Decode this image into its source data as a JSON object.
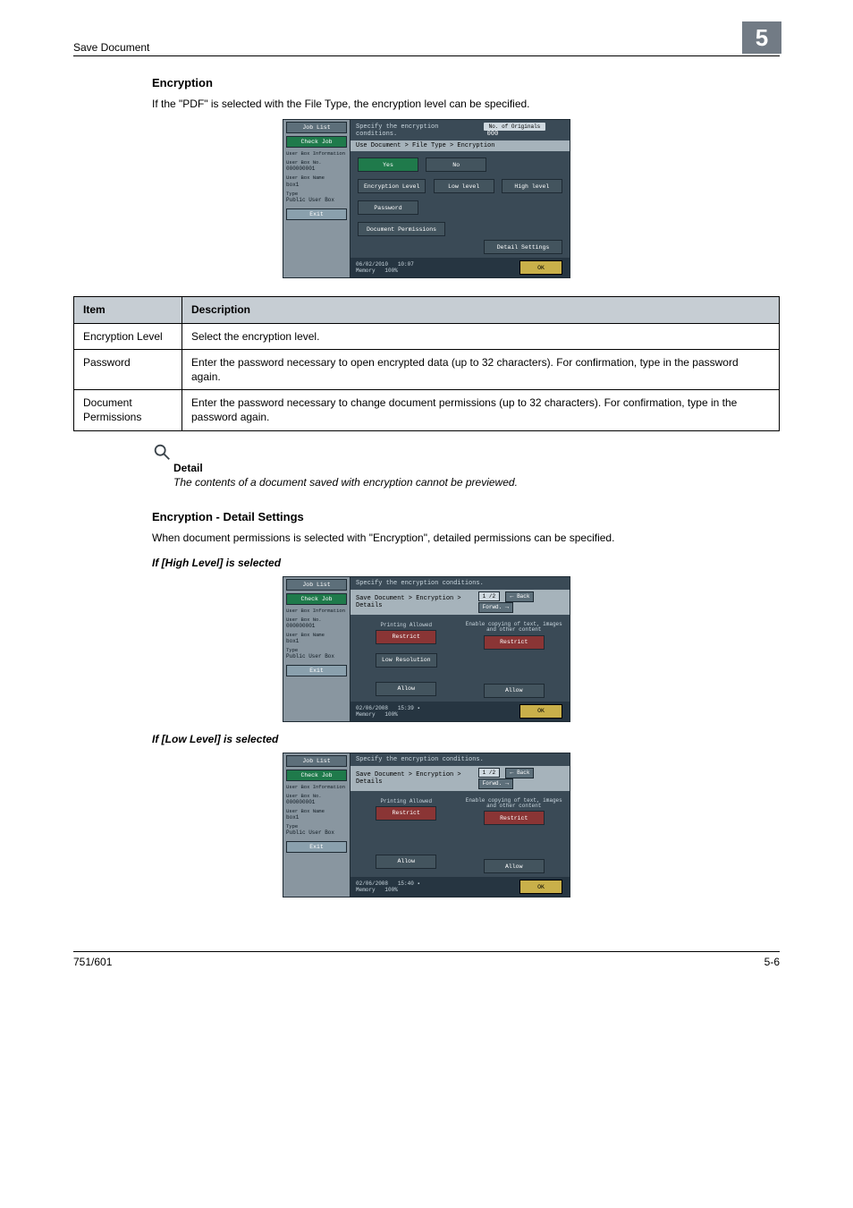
{
  "header": {
    "title": "Save Document",
    "chapter": "5"
  },
  "section1": {
    "heading": "Encryption",
    "intro": "If the \"PDF\" is selected with the File Type, the encryption level can be specified."
  },
  "table": {
    "h_item": "Item",
    "h_desc": "Description",
    "rows": [
      {
        "item": "Encryption Level",
        "desc": "Select the encryption level."
      },
      {
        "item": "Password",
        "desc": "Enter the password necessary to open encrypted data (up to 32 characters). For confirmation, type in the password again."
      },
      {
        "item": "Document Permissions",
        "desc": "Enter the password necessary to change document permissions (up to 32 characters). For confirmation, type in the password again."
      }
    ]
  },
  "detail": {
    "label": "Detail",
    "text": "The contents of a document saved with encryption cannot be previewed."
  },
  "section2": {
    "heading": "Encryption - Detail Settings",
    "intro": "When document permissions is selected with \"Encryption\", detailed permissions can be specified.",
    "case_high": "If [High Level] is selected",
    "case_low": "If [Low Level] is selected"
  },
  "panel_shared": {
    "job_list": "Job List",
    "check_job": "Check Job",
    "user_box_info": "User Box Information",
    "user_box_no_lbl": "User Box No.",
    "user_box_no_val": "000000001",
    "user_box_name_lbl": "User Box Name",
    "user_box_name_val": "box1",
    "type_lbl": "Type",
    "type_val": "Public User Box",
    "exit": "Exit",
    "memory_lbl": "Memory",
    "memory_val": "100%",
    "ok": "OK"
  },
  "panel1": {
    "title": "Specify the encryption conditions.",
    "count_lbl": "No. of Originals",
    "count_val": "000",
    "bread": "Use Document > File Type > Encryption",
    "yes": "Yes",
    "no": "No",
    "enc_level": "Encryption Level",
    "low": "Low level",
    "high": "High level",
    "password": "Password",
    "doc_perm": "Document Permissions",
    "detail_settings": "Detail Settings",
    "date": "06/02/2010",
    "time": "10:07"
  },
  "panel2": {
    "title": "Specify the encryption conditions.",
    "bread": "Save Document > Encryption > Details",
    "page": "1 /2",
    "back": "Back",
    "forwd": "Forwd.",
    "col1_title": "Printing Allowed",
    "col2_title": "Enable copying of text, images and other content",
    "restrict": "Restrict",
    "low_res": "Low Resolution",
    "allow": "Allow",
    "date": "02/06/2008",
    "time": "15:39"
  },
  "panel3": {
    "title": "Specify the encryption conditions.",
    "bread": "Save Document > Encryption > Details",
    "page": "1 /2",
    "back": "Back",
    "forwd": "Forwd.",
    "col1_title": "Printing Allowed",
    "col2_title": "Enable copying of text, images and other content",
    "restrict": "Restrict",
    "allow": "Allow",
    "date": "02/06/2008",
    "time": "15:40"
  },
  "footer": {
    "left": "751/601",
    "right": "5-6"
  }
}
